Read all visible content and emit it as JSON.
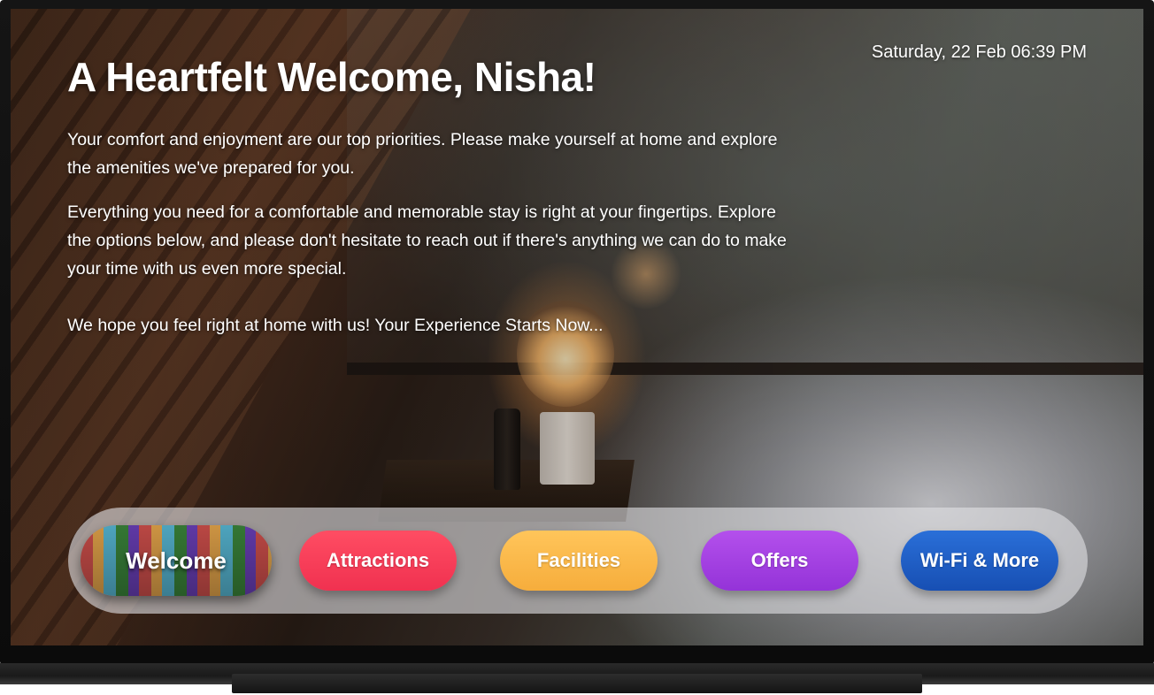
{
  "header": {
    "datetime": "Saturday, 22 Feb 06:39 PM",
    "title": "A Heartfelt Welcome, Nisha!"
  },
  "welcome": {
    "paragraphs": [
      "Your comfort and enjoyment are our top priorities.  Please make yourself at home and explore the amenities we've prepared for you.",
      "Everything you need for a comfortable and memorable stay is right at your fingertips.  Explore the options below, and please don't hesitate to reach out if there's anything we can do to make your time with us even more special.",
      "We hope you feel right at home with us! Your Experience Starts Now..."
    ]
  },
  "nav": {
    "items": [
      {
        "label": "Welcome",
        "color": "#6b4a3a",
        "selected": true
      },
      {
        "label": "Attractions",
        "color": "#f03150"
      },
      {
        "label": "Facilities",
        "color": "#f6ad3c"
      },
      {
        "label": "Offers",
        "color": "#9433d8"
      },
      {
        "label": "Wi-Fi & More",
        "color": "#174fb3"
      }
    ]
  }
}
